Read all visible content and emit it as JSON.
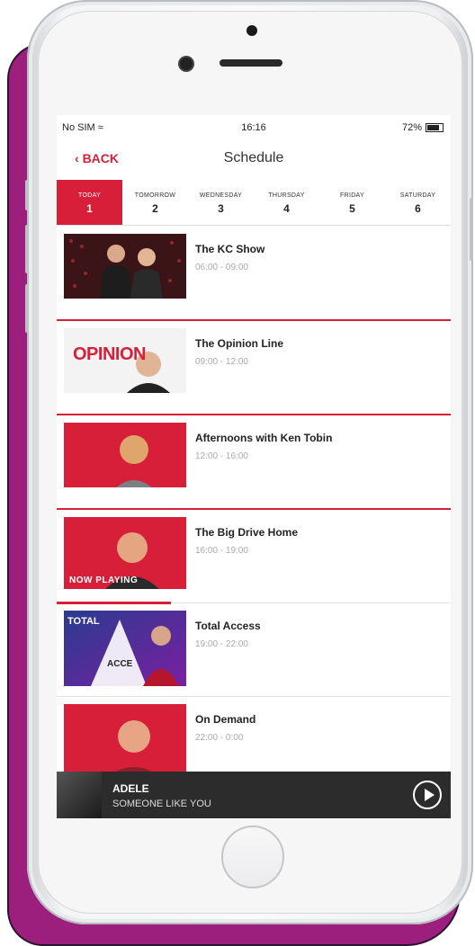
{
  "status": {
    "carrier": "No SIM",
    "time": "16:16",
    "battery": "72%"
  },
  "nav": {
    "back": "BACK",
    "title": "Schedule"
  },
  "days": [
    {
      "name": "TODAY",
      "num": "1"
    },
    {
      "name": "TOMORROW",
      "num": "2"
    },
    {
      "name": "WEDNESDAY",
      "num": "3"
    },
    {
      "name": "THURSDAY",
      "num": "4"
    },
    {
      "name": "FRIDAY",
      "num": "5"
    },
    {
      "name": "SATURDAY",
      "num": "6"
    }
  ],
  "shows": [
    {
      "title": "The KC Show",
      "time": "06:00 - 09:00"
    },
    {
      "title": "The Opinion Line",
      "time": "09:00 - 12:00"
    },
    {
      "title": "Afternoons with Ken Tobin",
      "time": "12:00 - 16:00"
    },
    {
      "title": "The Big Drive Home",
      "time": "16:00 - 19:00",
      "now_label": "NOW PLAYING",
      "progress": 0.29
    },
    {
      "title": "Total Access",
      "time": "19:00 - 22:00",
      "thumb_text": "TOTAL",
      "thumb_text2": "ACCE"
    },
    {
      "title": "On Demand",
      "time": "22:00 - 0:00"
    }
  ],
  "opinion_logo": "OPINION",
  "player": {
    "artist": "ADELE",
    "song": "SOMEONE LIKE YOU"
  },
  "colors": {
    "accent": "#d71f3a",
    "frame": "#9c1f7e"
  }
}
